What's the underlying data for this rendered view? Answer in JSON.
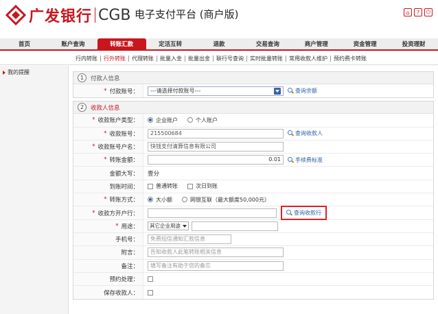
{
  "header": {
    "bank_name": "广发银行",
    "bank_en": "CGB",
    "platform": "电子支付平台 (商户版)"
  },
  "nav": [
    {
      "label": "首页"
    },
    {
      "label": "账户查询"
    },
    {
      "label": "转账汇款"
    },
    {
      "label": "定活互转"
    },
    {
      "label": "退款"
    },
    {
      "label": "交易查询"
    },
    {
      "label": "商户管理"
    },
    {
      "label": "资金管理"
    },
    {
      "label": "投资理财"
    }
  ],
  "subnav": [
    {
      "label": "行内转账"
    },
    {
      "label": "行外转账"
    },
    {
      "label": "代理转账"
    },
    {
      "label": "批量入金"
    },
    {
      "label": "批量出金"
    },
    {
      "label": "联行号查询"
    },
    {
      "label": "实时批量转账"
    },
    {
      "label": "常用收款人维护"
    },
    {
      "label": "预约费卡转账"
    }
  ],
  "sidebar": {
    "item": "我的提醒"
  },
  "section1": {
    "num": "1",
    "title": "付款人信息",
    "payer_account_label": "付款账号：",
    "payer_account_value": "---请选择付款账号---",
    "query_balance": "查询余额"
  },
  "section2": {
    "num": "2",
    "title": "收款人信息",
    "account_type_label": "收款账户类型：",
    "account_type_opt1": "企业账户",
    "account_type_opt2": "个人账户",
    "account_no_label": "收款账号：",
    "account_no_value": "215500684",
    "query_payee": "查询收款人",
    "account_name_label": "收款账号户名：",
    "account_name_value": "快钱支付清算信息有限公司",
    "amount_label": "转账金额：",
    "amount_value": "0.01",
    "fee_standard": "手续费标准",
    "amount_upper_label": "金额大写：",
    "amount_upper_value": "壹分",
    "arrival_label": "到账时间：",
    "arrival_opt1": "普通转账",
    "arrival_opt2": "次日到账",
    "method_label": "转账方式：",
    "method_opt1": "大小额",
    "method_opt2": "网银互联（最大额度50,000元）",
    "bank_label": "收款方开户行：",
    "query_bank": "查询收款行",
    "purpose_label": "用途：",
    "purpose_value": "其它企业用途",
    "phone_label": "手机号：",
    "phone_placeholder": "免费短信通知汇款信息",
    "note_label": "附言：",
    "note_placeholder": "告知收款人此笔转账相关信息",
    "memo_label": "备注：",
    "memo_placeholder": "填写备注有助于您的备忘",
    "schedule_label": "预约处理：",
    "save_label": "保存收款人："
  }
}
